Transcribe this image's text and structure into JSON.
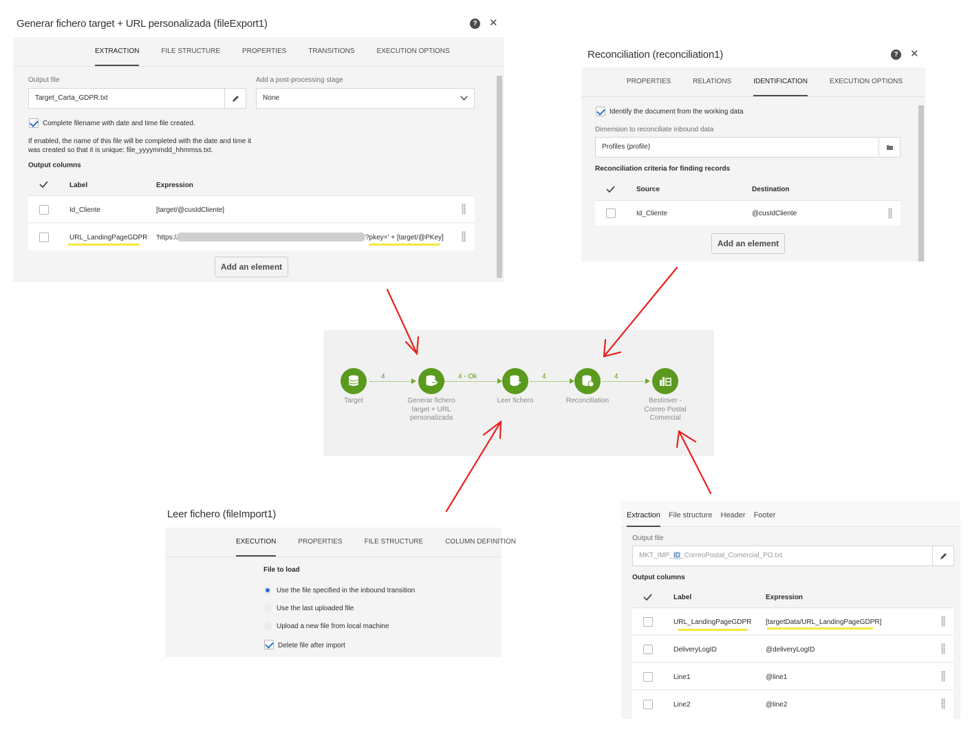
{
  "export_dialog": {
    "title": "Generar fichero target + URL personalizada (fileExport1)",
    "tabs": [
      "EXTRACTION",
      "FILE STRUCTURE",
      "PROPERTIES",
      "TRANSITIONS",
      "EXECUTION OPTIONS"
    ],
    "active_tab": "EXTRACTION",
    "output_file_label": "Output file",
    "output_file_value": "Target_Carta_GDPR.txt",
    "post_processing_label": "Add a post-processing stage",
    "post_processing_value": "None",
    "complete_filename_label": "Complete filename with date and time file created.",
    "complete_filename_checked": true,
    "help_line1": "If enabled, the name of this file will be completed with the date and time it",
    "help_line2": "was created so that it is unique: file_yyyymmdd_hhmmss.txt.",
    "output_columns_label": "Output columns",
    "col_label": "Label",
    "col_expression": "Expression",
    "rows": [
      {
        "label": "Id_Cliente",
        "expression": "[target/@cusIdCliente]"
      },
      {
        "label": "URL_LandingPageGDPR",
        "expression_prefix": "'https://",
        "expression_suffix": "?pkey=' + [target/@PKey]"
      }
    ],
    "add_button": "Add an element"
  },
  "reconciliation_dialog": {
    "title": "Reconciliation (reconciliation1)",
    "tabs": [
      "PROPERTIES",
      "RELATIONS",
      "IDENTIFICATION",
      "EXECUTION OPTIONS"
    ],
    "active_tab": "IDENTIFICATION",
    "identify_label": "Identify the document from the working data",
    "identify_checked": true,
    "dimension_label": "Dimension to reconciliate inbound data",
    "dimension_value": "Profiles (profile)",
    "criteria_label": "Reconciliation criteria for finding records",
    "col_source": "Source",
    "col_destination": "Destination",
    "rows": [
      {
        "source": "Id_Cliente",
        "destination": "@cusIdCliente"
      }
    ],
    "add_button": "Add an element"
  },
  "workflow": {
    "nodes": [
      {
        "label": "Target",
        "icon": "database-icon"
      },
      {
        "label": "Generar fichero target + URL personalizada",
        "icon": "database-export-icon"
      },
      {
        "label": "Leer fichero",
        "icon": "database-import-icon"
      },
      {
        "label": "Reconciliation",
        "icon": "database-reconcile-icon"
      },
      {
        "label": "Bestinver - Correo Postal Comercial",
        "icon": "delivery-icon"
      }
    ],
    "transitions": [
      "4",
      "4 - Ok",
      "4",
      "4"
    ]
  },
  "import_dialog": {
    "title": "Leer fichero (fileImport1)",
    "tabs": [
      "EXECUTION",
      "PROPERTIES",
      "FILE STRUCTURE",
      "COLUMN DEFINITION"
    ],
    "active_tab": "EXECUTION",
    "file_to_load_label": "File to load",
    "options": [
      "Use the file specified in the inbound transition",
      "Use the last uploaded file",
      "Upload a new file from local machine"
    ],
    "selected_option": 0,
    "delete_after_label": "Delete file after import",
    "delete_after_checked": true
  },
  "delivery_dialog": {
    "tabs": [
      "Extraction",
      "File structure",
      "Header",
      "Footer"
    ],
    "active_tab": "Extraction",
    "output_file_label": "Output file",
    "output_file_prefix": "MKT_IMP_",
    "output_file_highlight": "ID",
    "output_file_suffix": "_CorreoPostal_Comercial_PO.txt",
    "output_columns_label": "Output columns",
    "col_label": "Label",
    "col_expression": "Expression",
    "rows": [
      {
        "label": "URL_LandingPageGDPR",
        "expression": "[targetData/URL_LandingPageGDPR]"
      },
      {
        "label": "DeliveryLogID",
        "expression": "@deliveryLogID"
      },
      {
        "label": "Line1",
        "expression": "@line1"
      },
      {
        "label": "Line2",
        "expression": "@line2"
      }
    ]
  },
  "colors": {
    "node_green": "#5a9a1e",
    "annotation_arrow": "#e8201f",
    "highlight_yellow": "#f4e73a",
    "checkbox_blue": "#2d6dc9"
  }
}
